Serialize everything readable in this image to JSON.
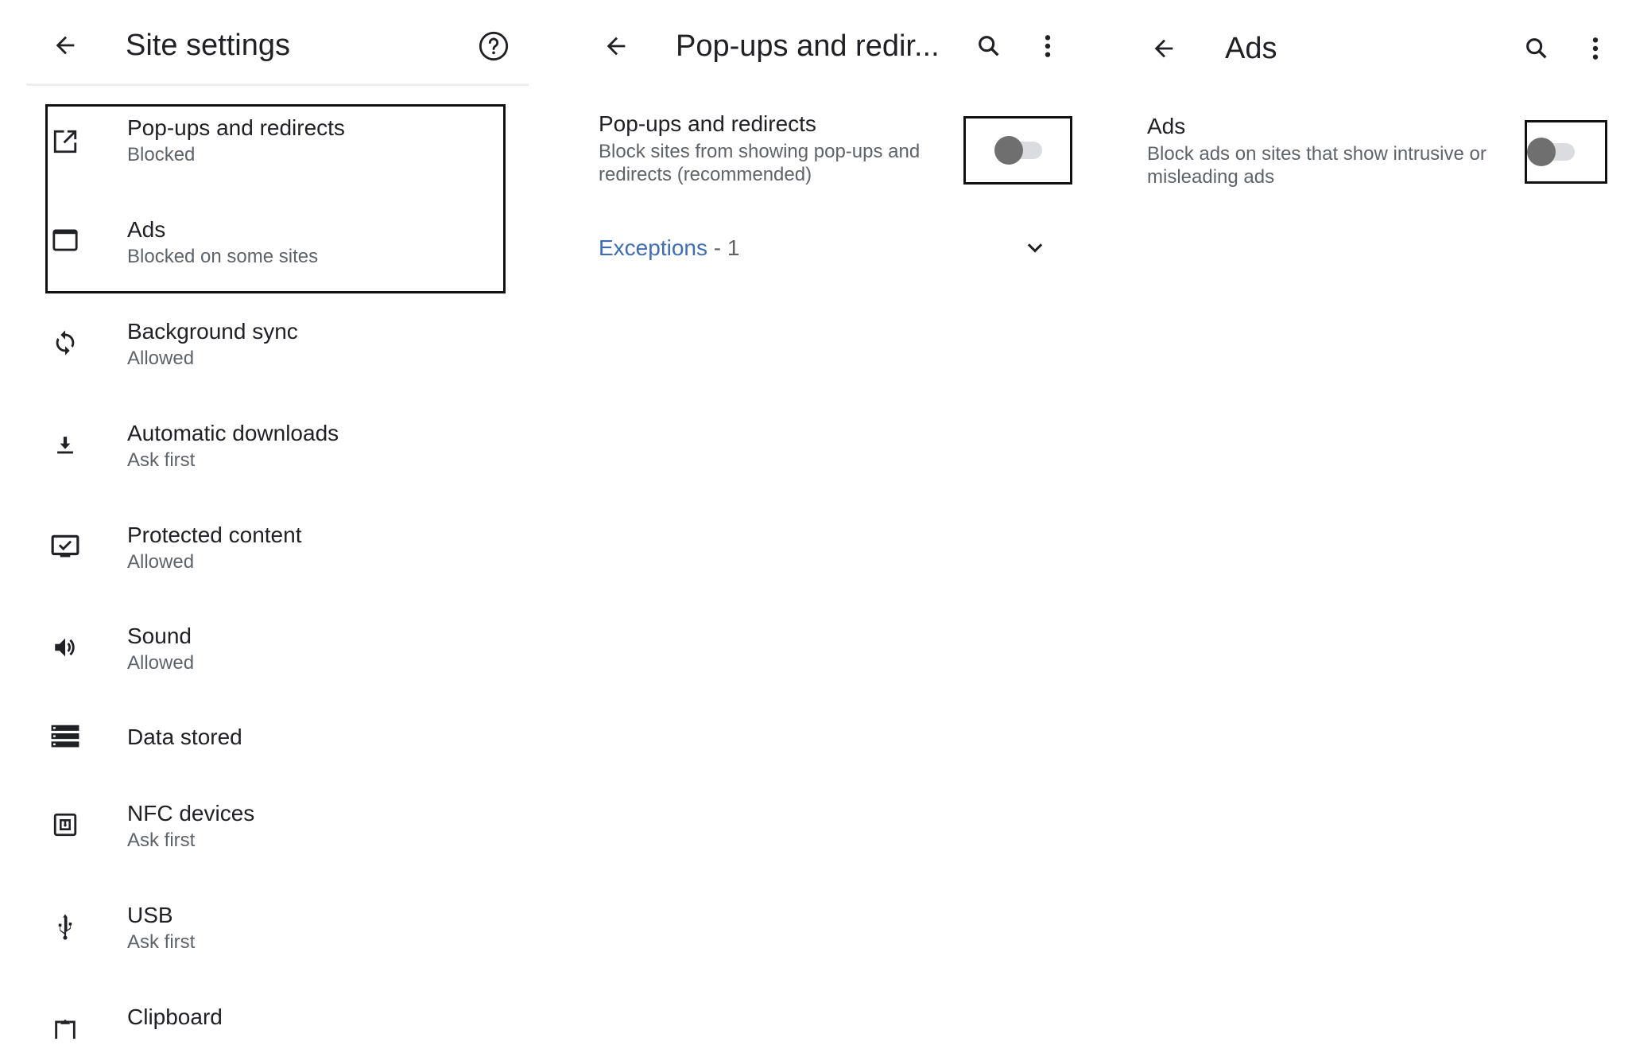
{
  "panels": {
    "site_settings": {
      "title": "Site settings",
      "icons": {
        "back": "arrow-back-icon",
        "help": "help-circle-icon"
      },
      "items": [
        {
          "title": "Pop-ups and redirects",
          "subtitle": "Blocked",
          "icon": "open-in-new-icon",
          "highlighted": true
        },
        {
          "title": "Ads",
          "subtitle": "Blocked on some sites",
          "icon": "web-asset-icon",
          "highlighted": true
        },
        {
          "title": "Background sync",
          "subtitle": "Allowed",
          "icon": "sync-icon"
        },
        {
          "title": "Automatic downloads",
          "subtitle": "Ask first",
          "icon": "download-icon"
        },
        {
          "title": "Protected content",
          "subtitle": "Allowed",
          "icon": "protected-content-icon"
        },
        {
          "title": "Sound",
          "subtitle": "Allowed",
          "icon": "volume-icon"
        },
        {
          "title": "Data stored",
          "subtitle": "",
          "icon": "storage-icon"
        },
        {
          "title": "NFC devices",
          "subtitle": "Ask first",
          "icon": "nfc-icon"
        },
        {
          "title": "USB",
          "subtitle": "Ask first",
          "icon": "usb-icon"
        },
        {
          "title": "Clipboard",
          "subtitle": "",
          "icon": "clipboard-icon"
        }
      ]
    },
    "popups": {
      "title": "Pop-ups and redir...",
      "icons": {
        "back": "arrow-back-icon",
        "search": "search-icon",
        "more": "more-vert-icon"
      },
      "setting_title": "Pop-ups and redirects",
      "setting_desc_line1": "Block sites from showing pop-ups and",
      "setting_desc_line2": "redirects (recommended)",
      "toggle_on": false,
      "exceptions_label": "Exceptions",
      "exceptions_count": " - 1"
    },
    "ads": {
      "title": "Ads",
      "icons": {
        "back": "arrow-back-icon",
        "search": "search-icon",
        "more": "more-vert-icon"
      },
      "setting_title": "Ads",
      "setting_desc_line1": "Block ads on sites that show intrusive or",
      "setting_desc_line2": "misleading ads",
      "toggle_on": false
    }
  },
  "colors": {
    "link": "#3f6db3",
    "text_primary": "#202124",
    "text_secondary": "#5f6368",
    "toggle_thumb_off": "#6f6f6f",
    "toggle_track_off": "#dadce0",
    "highlight_border": "#111111"
  }
}
